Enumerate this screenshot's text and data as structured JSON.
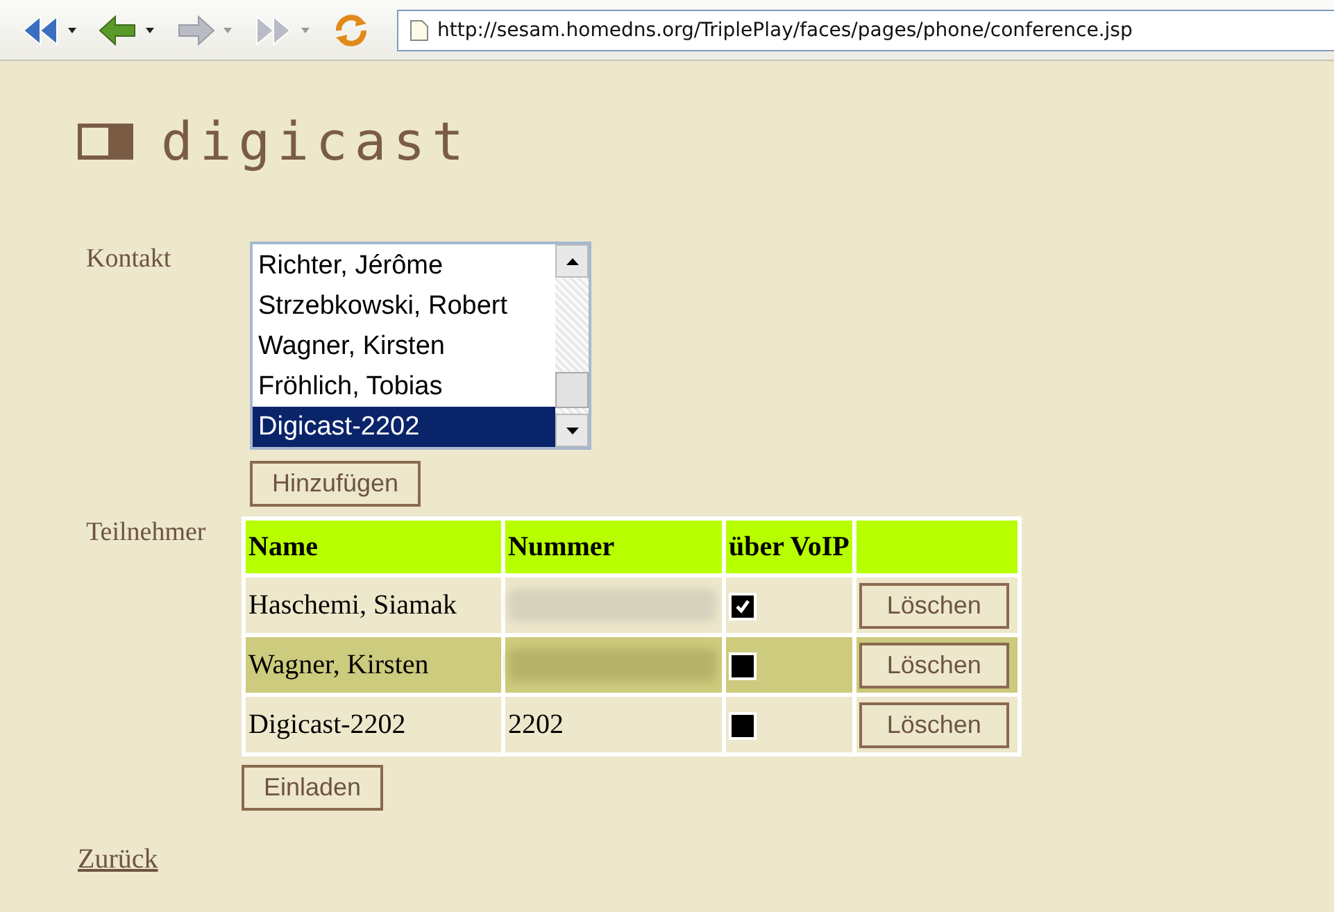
{
  "toolbar": {
    "buttons": [
      {
        "kind": "rewind",
        "disabled": false
      },
      {
        "kind": "back",
        "disabled": false
      },
      {
        "kind": "forward",
        "disabled": true
      },
      {
        "kind": "fastforward",
        "disabled": true
      },
      {
        "kind": "reload",
        "disabled": false
      }
    ],
    "address": "http://sesam.homedns.org/TriplePlay/faces/pages/phone/conference.jsp"
  },
  "logo": "digicast",
  "contact": {
    "label": "Kontakt",
    "items": [
      {
        "text": "Richter, Jérôme",
        "selected": false
      },
      {
        "text": "Strzebkowski, Robert",
        "selected": false
      },
      {
        "text": "Wagner, Kirsten",
        "selected": false
      },
      {
        "text": "Fröhlich, Tobias",
        "selected": false
      },
      {
        "text": "Digicast-2202",
        "selected": true
      }
    ],
    "add_button": "Hinzufügen"
  },
  "participants": {
    "label": "Teilnehmer",
    "columns": [
      "Name",
      "Nummer",
      "über VoIP"
    ],
    "rows": [
      {
        "name": "Haschemi, Siamak",
        "number_blurred": true,
        "voip": true,
        "highlighted": false,
        "delete": "Löschen"
      },
      {
        "name": "Wagner, Kirsten",
        "number_blurred": true,
        "voip": false,
        "highlighted": true,
        "delete": "Löschen"
      },
      {
        "name": "Digicast-2202",
        "number": "2202",
        "number_blurred": false,
        "voip": false,
        "highlighted": false,
        "delete": "Löschen"
      }
    ],
    "invite_button": "Einladen"
  },
  "back_link": "Zurück"
}
